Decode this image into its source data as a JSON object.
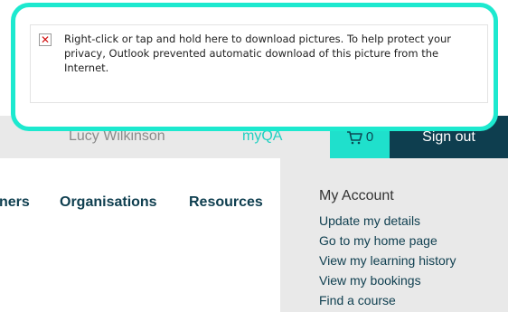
{
  "notice": {
    "text": "Right-click or tap and hold here to download pictures. To help protect your privacy, Outlook prevented automatic download of this picture from the Internet."
  },
  "topbar": {
    "user_name": "Lucy Wilkinson",
    "myqa_label": "myQA",
    "cart_count": "0",
    "signout_label": "Sign out"
  },
  "nav": {
    "items": [
      {
        "label": "ners"
      },
      {
        "label": "Organisations"
      },
      {
        "label": "Resources"
      }
    ]
  },
  "account": {
    "heading": "My Account",
    "links": [
      {
        "label": "Update my details"
      },
      {
        "label": "Go to my home page"
      },
      {
        "label": "View my learning history"
      },
      {
        "label": "View my bookings"
      },
      {
        "label": "Find a course"
      }
    ]
  },
  "colors": {
    "accent_teal": "#1fe0cc",
    "dark_navy": "#0e3e4f",
    "bar_grey": "#e9e9e9"
  }
}
